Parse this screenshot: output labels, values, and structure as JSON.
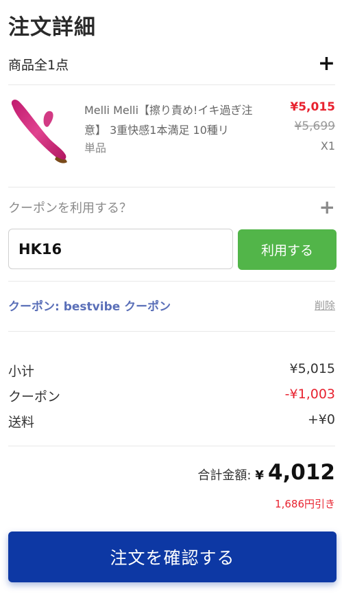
{
  "page_title": "注文詳細",
  "items_header": {
    "label": "商品全1点",
    "expand_icon": "plus-icon"
  },
  "product": {
    "name": "Melli Melli【擦り責め!イキ過ぎ注意】 3重快感1本満足 10種リ",
    "variant": "単品",
    "price": "¥5,015",
    "original_price": "¥5,699",
    "quantity": "X1",
    "image_icon": "product-thumbnail",
    "colors": {
      "price": "#e8222f"
    }
  },
  "coupon": {
    "header_label": "クーポンを利用する？",
    "expand_icon": "plus-icon",
    "input_value": "HK16",
    "apply_label": "利用する",
    "applied_text": "クーポン: bestvibe クーポン",
    "remove_label": "削除",
    "colors": {
      "apply_button": "#52b549",
      "applied_text": "#5a6fb8"
    }
  },
  "summary": {
    "subtotal_label": "小计",
    "subtotal_value": "¥5,015",
    "coupon_label": "クーポン",
    "coupon_value": "-¥1,003",
    "shipping_label": "送料",
    "shipping_value": "+¥0"
  },
  "total": {
    "label": "合計金額:",
    "currency": "¥",
    "amount": "4,012",
    "discount_note": "1,686円引き"
  },
  "confirm_button": {
    "label": "注文を確認する",
    "color": "#0d38a4"
  }
}
